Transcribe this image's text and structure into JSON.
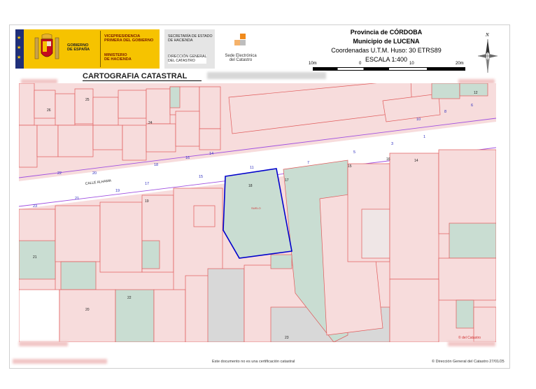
{
  "header": {
    "gobierno": "GOBIERNO\nDE ESPAÑA",
    "vicepresidencia": "VICEPRESIDENCIA\nPRIMERA DEL GOBIERNO",
    "ministerio": "MINISTERIO\nDE HACIENDA",
    "secretaria": "SECRETARÍA DE ESTADO\nDE HACIENDA",
    "direccion": "DIRECCIÓN GENERAL\nDEL CATASTRO",
    "sede": "Sede Electrónica\ndel Catastro",
    "provincia": "Provincia de CÓRDOBA",
    "municipio": "Municipio de LUCENA",
    "coordenadas": "Coordenadas U.T.M. Huso: 30 ETRS89",
    "escala": "ESCALA 1:400",
    "scale_labels": [
      "10m",
      "0",
      "10",
      "20m"
    ],
    "north": "N",
    "title": "CARTOGRAFIA CATASTRAL"
  },
  "map": {
    "street": "CALLE ALHAMA",
    "highlight_label": "SUELO",
    "parcel_labels": [
      "26",
      "25",
      "24",
      "21",
      "20",
      "22",
      "23",
      "19",
      "18",
      "17",
      "16",
      "15",
      "14",
      "12",
      "11",
      "9",
      "8",
      "6",
      "5",
      "3",
      "1",
      "35",
      "31",
      "30",
      "32",
      "36"
    ],
    "street_numbers": [
      "23",
      "21",
      "19",
      "22",
      "20",
      "18",
      "17",
      "16",
      "15",
      "14",
      "11",
      "7",
      "5",
      "3",
      "1",
      "10",
      "8",
      "6"
    ],
    "watermark": "© del Catastro"
  },
  "footer": {
    "note": "Este documento no es una certificación catastral",
    "copyright": "© Dirección General del Catastro 27/01/25"
  },
  "colors": {
    "parcel_fill": "#f7dcdc",
    "parcel_line": "#e05a5a",
    "green_fill": "#c9ddd2",
    "grey_fill": "#d8d8d8",
    "street_fill": "#ffffff",
    "highlight": "#0000cc",
    "gov_yellow": "#f6c300"
  }
}
